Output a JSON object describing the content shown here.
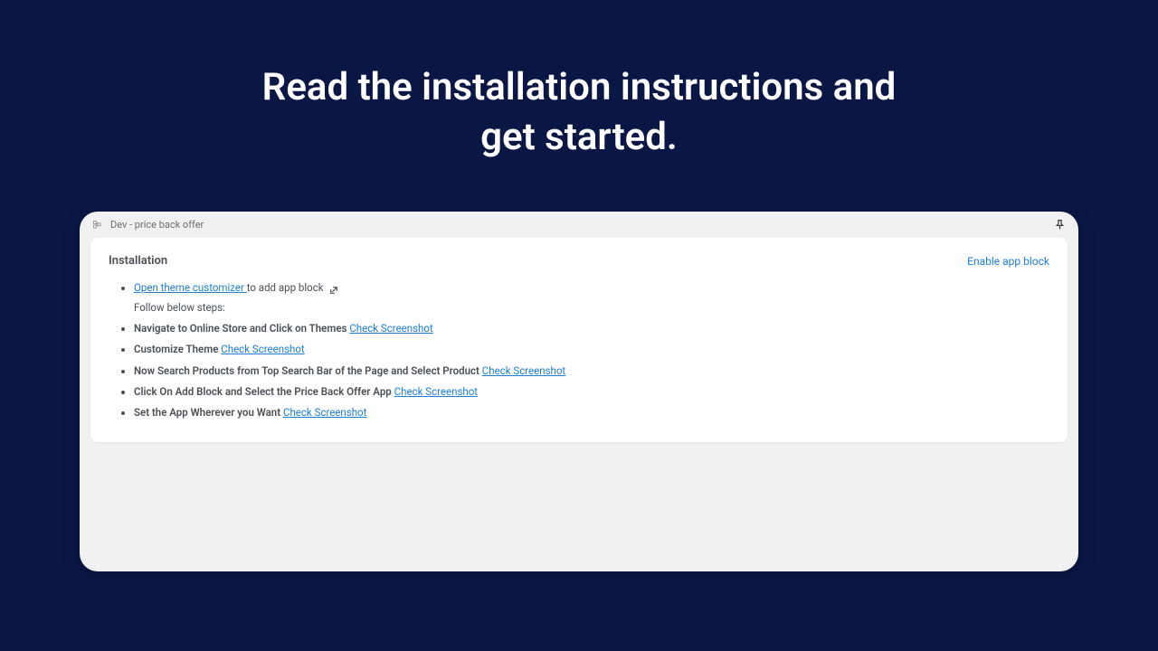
{
  "headline": {
    "line1": "Read the installation instructions and",
    "line2": "get started."
  },
  "titlebar": {
    "app_name": "Dev - price back offer"
  },
  "panel": {
    "title": "Installation",
    "enable_link": "Enable app block"
  },
  "steps": {
    "step1": {
      "link_text": "Open theme customizer ",
      "suffix": "to add app block",
      "substep": "Follow below steps:"
    },
    "step2": {
      "bold": "Navigate to Online Store and Click on Themes",
      "link": "Check Screenshot"
    },
    "step3": {
      "bold": "Customize Theme",
      "link": "Check Screenshot"
    },
    "step4": {
      "bold": "Now Search Products from Top Search Bar of the Page and Select Product",
      "link": "Check Screenshot"
    },
    "step5": {
      "bold": "Click On Add Block and Select the Price Back Offer App",
      "link": "Check Screenshot"
    },
    "step6": {
      "bold": "Set the App Wherever you Want",
      "link": "Check Screenshot"
    }
  }
}
